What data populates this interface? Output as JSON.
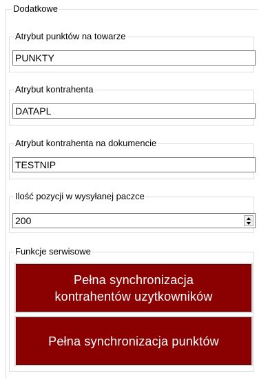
{
  "form": {
    "section_title": "Dodatkowe",
    "product_points_attribute": {
      "label": "Atrybut punktów na towarze",
      "value": "PUNKTY"
    },
    "contractor_attribute": {
      "label": "Atrybut kontrahenta",
      "value": "DATAPL"
    },
    "document_contractor_attribute": {
      "label": "Atrybut kontrahenta na dokumencie",
      "value": "TESTNIP"
    },
    "batch_size": {
      "label": "Ilość pozycji w wysyłanej paczce",
      "value": "200",
      "up_icon": "spin-up-icon",
      "down_icon": "spin-down-icon"
    },
    "service_functions": {
      "label": "Funkcje serwisowe",
      "sync_contractors_line1": "Pełna synchronizacja",
      "sync_contractors_line2": "kontrahentów uzytkowników",
      "sync_points_label": "Pełna synchronizacja punktów",
      "button_color": "#8b0000"
    }
  }
}
